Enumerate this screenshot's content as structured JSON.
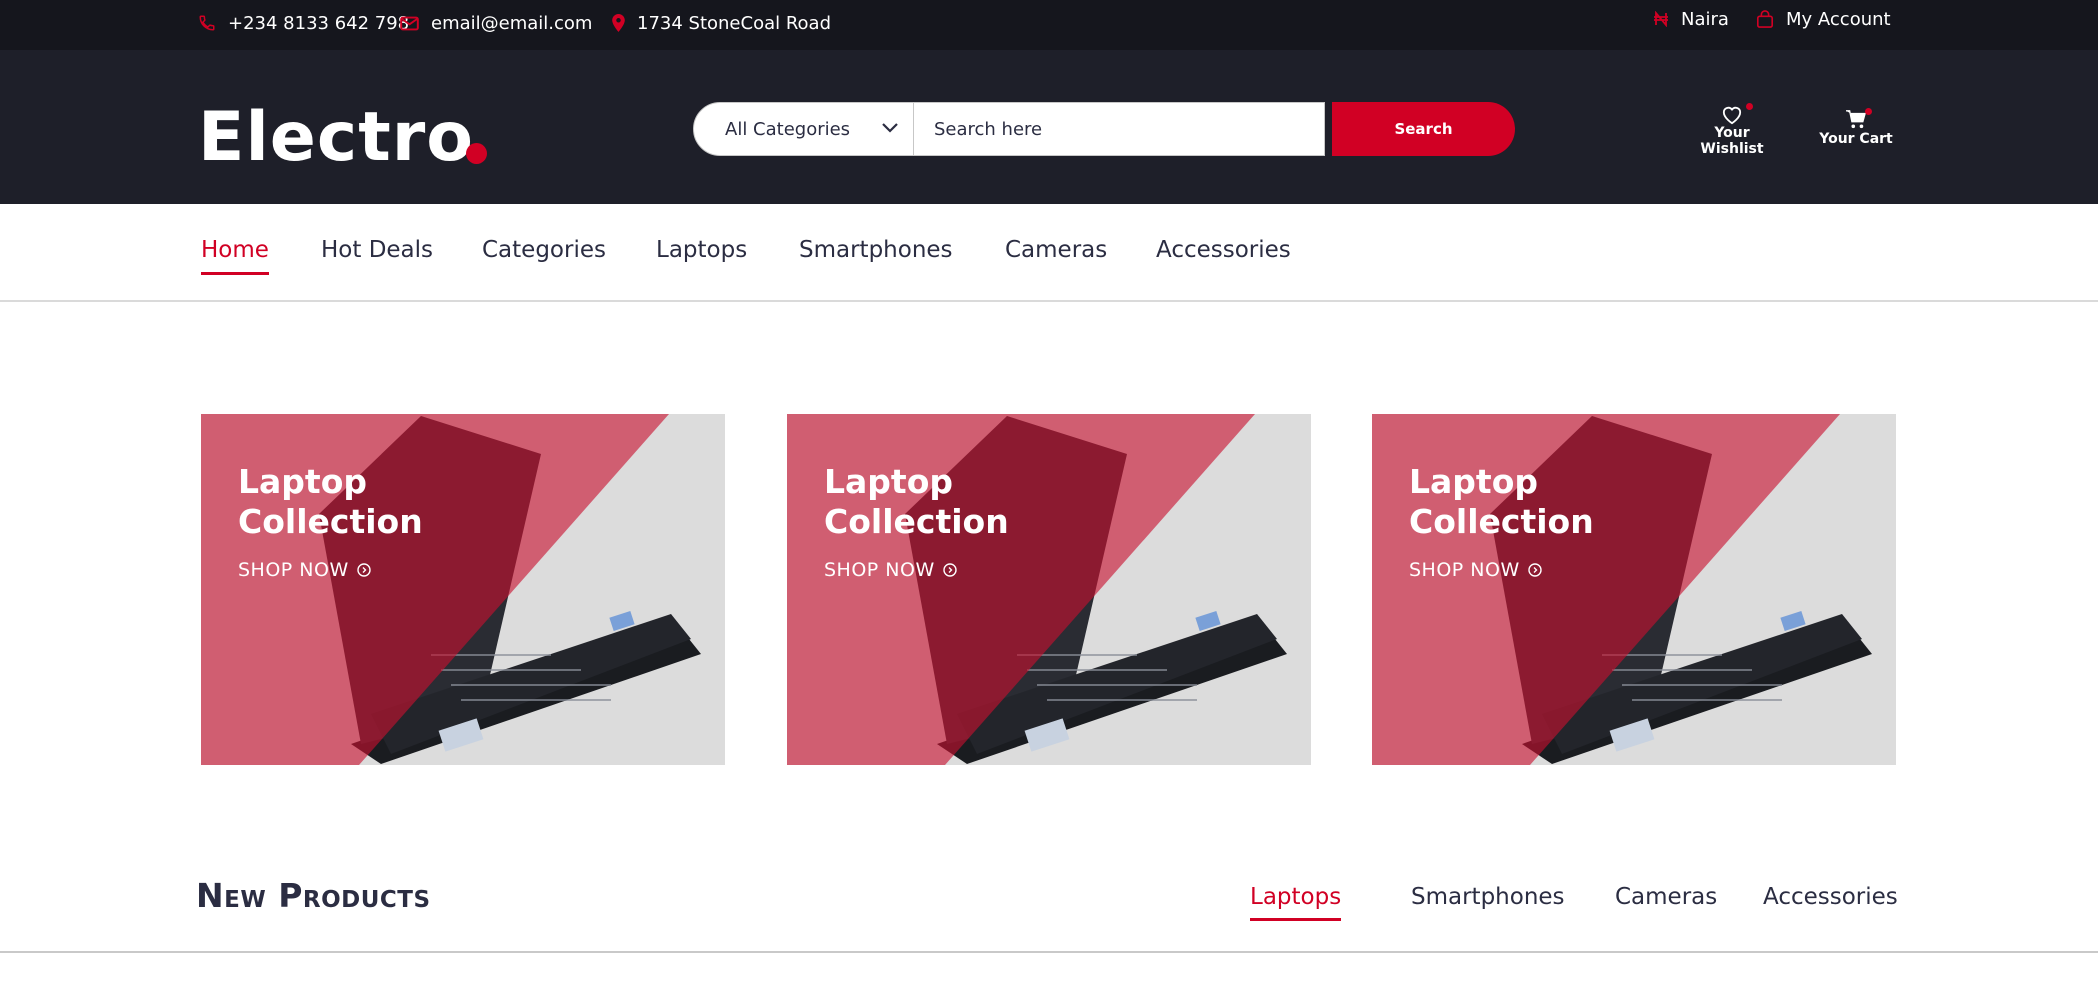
{
  "topbar": {
    "phone": "+234 8133 642 798",
    "email": "email@email.com",
    "address": "1734 StoneCoal Road",
    "currency": "Naira",
    "account": "My Account"
  },
  "header": {
    "logo": "Electro",
    "search": {
      "category": "All Categories",
      "placeholder": "Search here",
      "button": "Search"
    },
    "wishlist_label": "Your Wishlist",
    "cart_label": "Your Cart"
  },
  "nav": {
    "items": [
      "Home",
      "Hot Deals",
      "Categories",
      "Laptops",
      "Smartphones",
      "Cameras",
      "Accessories"
    ],
    "active": "Home"
  },
  "banners": [
    {
      "title": "Laptop\nCollection",
      "cta": "SHOP NOW"
    },
    {
      "title": "Laptop\nCollection",
      "cta": "SHOP NOW"
    },
    {
      "title": "Laptop\nCollection",
      "cta": "SHOP NOW"
    }
  ],
  "new_products": {
    "title": "New Products",
    "tabs": [
      "Laptops",
      "Smartphones",
      "Cameras",
      "Accessories"
    ],
    "active_tab": "Laptops"
  },
  "colors": {
    "accent": "#d10024",
    "topbar_bg": "#15161d",
    "header_bg": "#1e1f29"
  },
  "icons": [
    "phone-icon",
    "mail-icon",
    "map-pin-icon",
    "naira-icon",
    "bag-icon",
    "heart-icon",
    "cart-icon",
    "chevron-down-icon",
    "arrow-circle-right-icon"
  ]
}
